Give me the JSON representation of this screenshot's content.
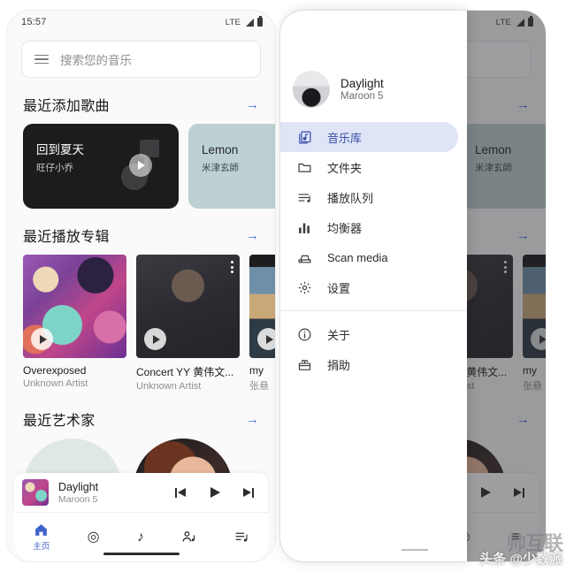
{
  "app": {
    "name": "music-player",
    "accent_color": "#3f62c9",
    "drawer_selected_bg": "#dfe4f7",
    "drawer_selected_text": "#3a4fa8"
  },
  "status_bar": {
    "time": "15:57",
    "network": "LTE",
    "signal_icon": "signal-bars-icon",
    "battery_icon": "battery-icon"
  },
  "search": {
    "menu_icon": "hamburger-menu-icon",
    "placeholder": "搜索您的音乐"
  },
  "sections": {
    "recent_songs": {
      "title": "最近添加歌曲",
      "more_icon": "arrow-right-icon",
      "cards": [
        {
          "title": "回到夏天",
          "artist": "旺仔小乔",
          "bg": "#1c1c1e",
          "theme": "dark",
          "play_icon": "play-icon",
          "art_icon": "music-note-icon"
        },
        {
          "title": "Lemon",
          "artist": "米津玄師",
          "bg": "#bdd0d2",
          "theme": "mint",
          "play_icon": "play-icon",
          "art_icon": "music-note-icon"
        }
      ]
    },
    "recent_albums": {
      "title": "最近播放专辑",
      "more_icon": "arrow-right-icon",
      "albums": [
        {
          "title": "Overexposed",
          "artist": "Unknown Artist",
          "art": "art-maroon",
          "play_icon": "play-icon",
          "menu_icon": "kebab-menu-icon",
          "has_menu": false
        },
        {
          "title": "Concert YY 黄伟文...",
          "artist": "Unknown Artist",
          "art": "art-concert",
          "play_icon": "play-icon",
          "menu_icon": "kebab-menu-icon",
          "has_menu": true
        },
        {
          "title": "my",
          "artist": "张悬",
          "art": "art-my",
          "play_icon": "play-icon",
          "menu_icon": "kebab-menu-icon",
          "has_menu": false
        }
      ]
    },
    "recent_artists": {
      "title": "最近艺术家",
      "more_icon": "arrow-right-icon",
      "artists": [
        {
          "avatar": "av-mint"
        },
        {
          "avatar": "av-lana"
        }
      ]
    }
  },
  "mini_player": {
    "title": "Daylight",
    "artist": "Maroon 5",
    "artwork_icon": "album-art-thumbnail",
    "prev_icon": "skip-previous-icon",
    "play_icon": "play-icon",
    "next_icon": "skip-next-icon"
  },
  "bottom_nav": {
    "items": [
      {
        "label": "主页",
        "icon": "home-icon",
        "glyph": "⌂",
        "active": true
      },
      {
        "label": "",
        "icon": "disc-icon",
        "glyph": "◎",
        "active": false
      },
      {
        "label": "",
        "icon": "music-note-icon",
        "glyph": "♪",
        "active": false
      },
      {
        "label": "",
        "icon": "artist-icon",
        "glyph": "☺",
        "active": false
      },
      {
        "label": "",
        "icon": "playlist-icon",
        "glyph": "≡",
        "active": false
      }
    ]
  },
  "drawer": {
    "now_playing": {
      "title": "Daylight",
      "artist": "Maroon 5",
      "avatar_icon": "artist-avatar"
    },
    "items": [
      {
        "label": "音乐库",
        "icon": "library-music-icon",
        "selected": true
      },
      {
        "label": "文件夹",
        "icon": "folder-icon",
        "selected": false
      },
      {
        "label": "播放队列",
        "icon": "queue-icon",
        "selected": false
      },
      {
        "label": "均衡器",
        "icon": "equalizer-icon",
        "selected": false
      },
      {
        "label": "Scan media",
        "icon": "scanner-icon",
        "selected": false
      },
      {
        "label": "设置",
        "icon": "gear-icon",
        "selected": false
      }
    ],
    "footer_items": [
      {
        "label": "关于",
        "icon": "info-icon",
        "selected": false
      },
      {
        "label": "捐助",
        "icon": "donate-icon",
        "selected": false
      }
    ]
  },
  "watermark": {
    "big": "帅互联",
    "small": "头条 @少数派"
  }
}
